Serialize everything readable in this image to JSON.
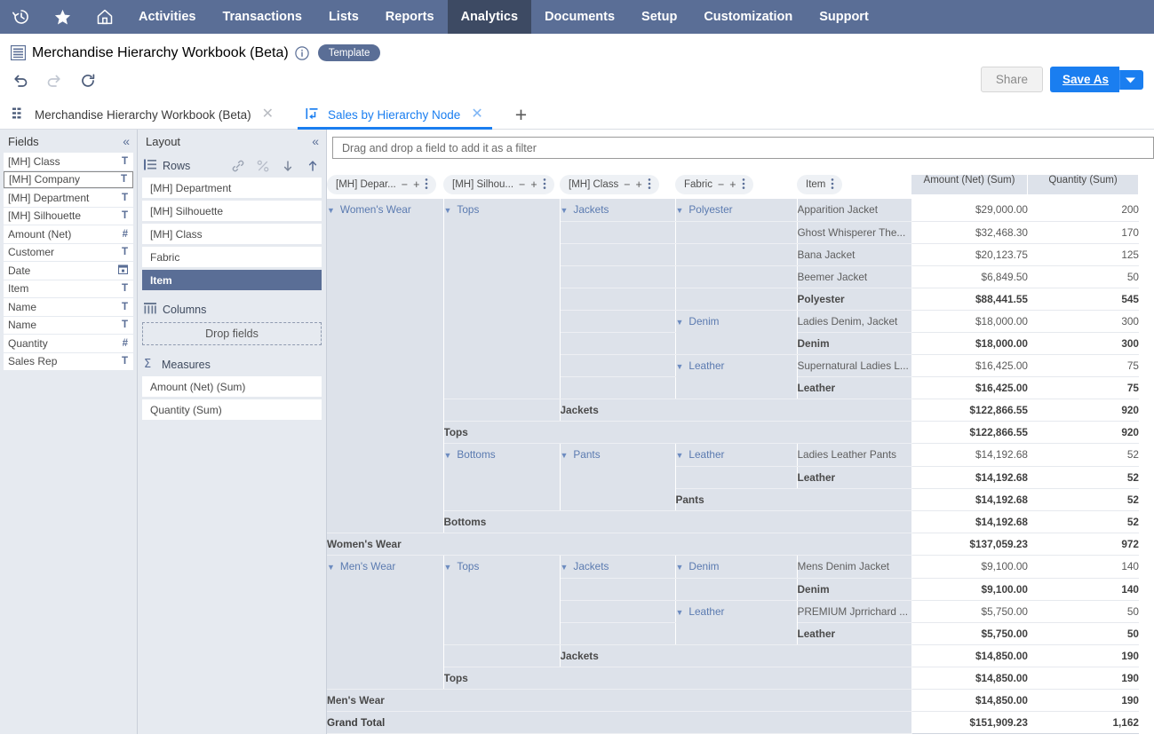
{
  "topnav": {
    "icons": [
      {
        "name": "recent-history-icon",
        "glyph": "history"
      },
      {
        "name": "shortcuts-star-icon",
        "glyph": "star"
      },
      {
        "name": "home-icon",
        "glyph": "home"
      }
    ],
    "items": [
      {
        "label": "Activities",
        "active": false
      },
      {
        "label": "Transactions",
        "active": false
      },
      {
        "label": "Lists",
        "active": false
      },
      {
        "label": "Reports",
        "active": false
      },
      {
        "label": "Analytics",
        "active": true
      },
      {
        "label": "Documents",
        "active": false
      },
      {
        "label": "Setup",
        "active": false
      },
      {
        "label": "Customization",
        "active": false
      },
      {
        "label": "Support",
        "active": false
      }
    ],
    "bg_color": "#5a6e96",
    "active_bg_color": "#3d4a63"
  },
  "header": {
    "title": "Merchandise Hierarchy Workbook (Beta)",
    "badge": "Template",
    "info_tooltip": "i"
  },
  "toolbar": {
    "undo_label": "Undo",
    "redo_label": "Redo",
    "refresh_label": "Refresh",
    "share_label": "Share",
    "save_as_label": "Save As",
    "primary_color": "#1a7ef0"
  },
  "tabs": {
    "items": [
      {
        "label": "Merchandise Hierarchy Workbook (Beta)",
        "icon": "dataset-icon",
        "active": false,
        "close": "✕"
      },
      {
        "label": "Sales by Hierarchy Node",
        "icon": "pivot-icon",
        "active": true,
        "close": "✕"
      }
    ],
    "add_label": "+"
  },
  "fields_panel": {
    "title": "Fields",
    "collapse": "«",
    "items": [
      {
        "label": "[MH] Class",
        "type": "T",
        "selected": false
      },
      {
        "label": "[MH] Company",
        "type": "T",
        "selected": true
      },
      {
        "label": "[MH] Department",
        "type": "T",
        "selected": false
      },
      {
        "label": "[MH] Silhouette",
        "type": "T",
        "selected": false
      },
      {
        "label": "Amount (Net)",
        "type": "#",
        "selected": false
      },
      {
        "label": "Customer",
        "type": "T",
        "selected": false
      },
      {
        "label": "Date",
        "type": "date",
        "selected": false
      },
      {
        "label": "Item",
        "type": "T",
        "selected": false
      },
      {
        "label": "Name",
        "type": "T",
        "selected": false
      },
      {
        "label": "Name",
        "type": "T",
        "selected": false
      },
      {
        "label": "Quantity",
        "type": "#",
        "selected": false
      },
      {
        "label": "Sales Rep",
        "type": "T",
        "selected": false
      }
    ]
  },
  "layout_panel": {
    "title": "Layout",
    "collapse": "«",
    "rows": {
      "label": "Rows",
      "tools": [
        "link-icon",
        "unlink-icon",
        "sort-down-icon",
        "sort-up-icon"
      ],
      "items": [
        {
          "label": "[MH] Department",
          "active": false
        },
        {
          "label": "[MH] Silhouette",
          "active": false
        },
        {
          "label": "[MH] Class",
          "active": false
        },
        {
          "label": "Fabric",
          "active": false
        },
        {
          "label": "Item",
          "active": true
        }
      ]
    },
    "columns": {
      "label": "Columns",
      "dropzone": "Drop fields"
    },
    "measures": {
      "label": "Measures",
      "items": [
        {
          "label": "Amount (Net) (Sum)"
        },
        {
          "label": "Quantity (Sum)"
        }
      ]
    }
  },
  "filter_bar": {
    "placeholder": "Drag and drop a field to add it as a filter"
  },
  "pivot": {
    "dimension_headers": [
      {
        "label": "[MH] Depar...",
        "has_minus": true,
        "has_plus": true,
        "has_kebab": true
      },
      {
        "label": "[MH] Silhou...",
        "has_minus": true,
        "has_plus": true,
        "has_kebab": true
      },
      {
        "label": "[MH] Class",
        "has_minus": true,
        "has_plus": true,
        "has_kebab": true
      },
      {
        "label": "Fabric",
        "has_minus": true,
        "has_plus": true,
        "has_kebab": true
      },
      {
        "label": "Item",
        "has_minus": false,
        "has_plus": false,
        "has_kebab": true
      }
    ],
    "measure_headers": [
      "Amount (Net) (Sum)",
      "Quantity (Sum)"
    ],
    "rows": [
      {
        "department": "Women's Wear",
        "silhouette": "Tops",
        "class": "Jackets",
        "fabric": "Polyester",
        "item": "Apparition Jacket",
        "amount": "$29,000.00",
        "quantity": "200",
        "bold": false
      },
      {
        "department": "",
        "silhouette": "",
        "class": "",
        "fabric": "",
        "item": "Ghost Whisperer The...",
        "amount": "$32,468.30",
        "quantity": "170",
        "bold": false
      },
      {
        "department": "",
        "silhouette": "",
        "class": "",
        "fabric": "",
        "item": "Bana Jacket",
        "amount": "$20,123.75",
        "quantity": "125",
        "bold": false
      },
      {
        "department": "",
        "silhouette": "",
        "class": "",
        "fabric": "",
        "item": "Beemer Jacket",
        "amount": "$6,849.50",
        "quantity": "50",
        "bold": false
      },
      {
        "department": "",
        "silhouette": "",
        "class": "",
        "fabric": "",
        "item": "Polyester",
        "amount": "$88,441.55",
        "quantity": "545",
        "bold": true
      },
      {
        "department": "",
        "silhouette": "",
        "class": "",
        "fabric": "Denim",
        "item": "Ladies Denim, Jacket",
        "amount": "$18,000.00",
        "quantity": "300",
        "bold": false
      },
      {
        "department": "",
        "silhouette": "",
        "class": "",
        "fabric": "",
        "item": "Denim",
        "amount": "$18,000.00",
        "quantity": "300",
        "bold": true
      },
      {
        "department": "",
        "silhouette": "",
        "class": "",
        "fabric": "Leather",
        "item": "Supernatural Ladies L...",
        "amount": "$16,425.00",
        "quantity": "75",
        "bold": false
      },
      {
        "department": "",
        "silhouette": "",
        "class": "",
        "fabric": "",
        "item": "Leather",
        "amount": "$16,425.00",
        "quantity": "75",
        "bold": true
      },
      {
        "department": "",
        "silhouette": "",
        "class": "Jackets",
        "fabric": "",
        "item": "",
        "amount": "$122,866.55",
        "quantity": "920",
        "bold": true
      },
      {
        "department": "",
        "silhouette": "Tops",
        "class": "",
        "fabric": "",
        "item": "",
        "amount": "$122,866.55",
        "quantity": "920",
        "bold": true
      },
      {
        "department": "",
        "silhouette": "Bottoms",
        "class": "Pants",
        "fabric": "Leather",
        "item": "Ladies Leather Pants",
        "amount": "$14,192.68",
        "quantity": "52",
        "bold": false
      },
      {
        "department": "",
        "silhouette": "",
        "class": "",
        "fabric": "",
        "item": "Leather",
        "amount": "$14,192.68",
        "quantity": "52",
        "bold": true
      },
      {
        "department": "",
        "silhouette": "",
        "class": "Pants",
        "fabric": "",
        "item": "",
        "amount": "$14,192.68",
        "quantity": "52",
        "bold": true
      },
      {
        "department": "",
        "silhouette": "Bottoms",
        "class": "",
        "fabric": "",
        "item": "",
        "amount": "$14,192.68",
        "quantity": "52",
        "bold": true
      },
      {
        "department": "Women's Wear",
        "silhouette": "",
        "class": "",
        "fabric": "",
        "item": "",
        "amount": "$137,059.23",
        "quantity": "972",
        "bold": true
      },
      {
        "department": "Men's Wear",
        "silhouette": "Tops",
        "class": "Jackets",
        "fabric": "Denim",
        "item": "Mens Denim Jacket",
        "amount": "$9,100.00",
        "quantity": "140",
        "bold": false
      },
      {
        "department": "",
        "silhouette": "",
        "class": "",
        "fabric": "",
        "item": "Denim",
        "amount": "$9,100.00",
        "quantity": "140",
        "bold": true
      },
      {
        "department": "",
        "silhouette": "",
        "class": "",
        "fabric": "Leather",
        "item": "PREMIUM Jprrichard ...",
        "amount": "$5,750.00",
        "quantity": "50",
        "bold": false
      },
      {
        "department": "",
        "silhouette": "",
        "class": "",
        "fabric": "",
        "item": "Leather",
        "amount": "$5,750.00",
        "quantity": "50",
        "bold": true
      },
      {
        "department": "",
        "silhouette": "",
        "class": "Jackets",
        "fabric": "",
        "item": "",
        "amount": "$14,850.00",
        "quantity": "190",
        "bold": true
      },
      {
        "department": "",
        "silhouette": "Tops",
        "class": "",
        "fabric": "",
        "item": "",
        "amount": "$14,850.00",
        "quantity": "190",
        "bold": true
      },
      {
        "department": "Men's Wear",
        "silhouette": "",
        "class": "",
        "fabric": "",
        "item": "",
        "amount": "$14,850.00",
        "quantity": "190",
        "bold": true
      }
    ],
    "grand_total": {
      "label": "Grand Total",
      "amount": "$151,909.23",
      "quantity": "1,162"
    }
  }
}
